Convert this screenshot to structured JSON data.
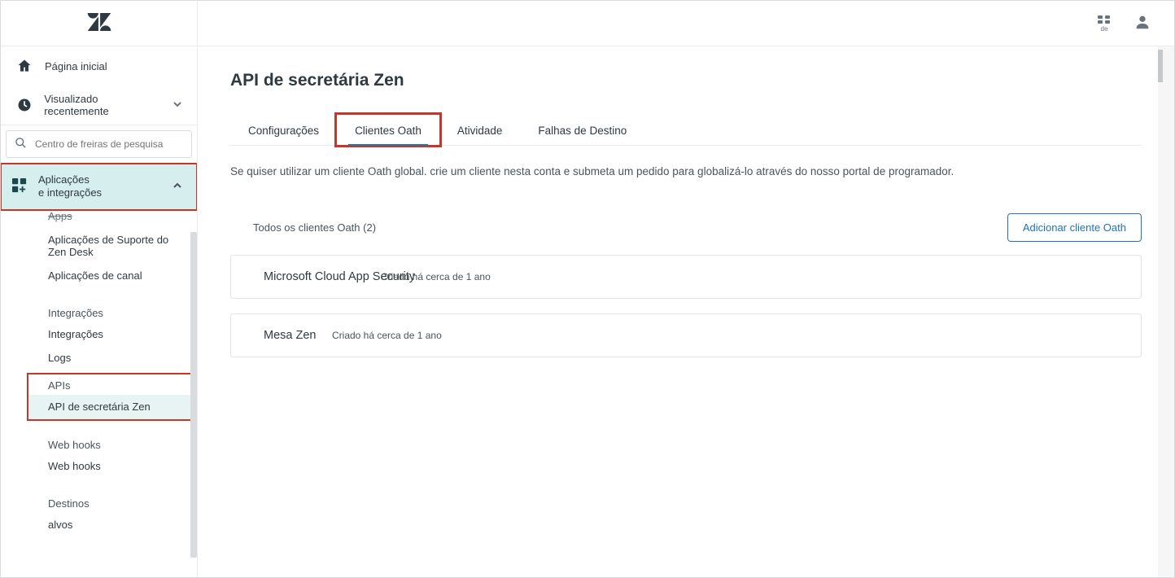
{
  "topbar": {
    "apps_caption": "de"
  },
  "sidebar": {
    "home": "Página inicial",
    "recent": "Visualizado recentemente",
    "search_placeholder": "Centro de freiras de pesquisa",
    "section_apps_line1": "Aplicações",
    "section_apps_line2": "e integrações",
    "items": {
      "apps_partial": "Apps",
      "support_apps": "Aplicações de Suporte do Zen Desk",
      "channel_apps": "Aplicações de canal",
      "integrations_group": "Integrações",
      "integrations": "Integrações",
      "logs": "Logs",
      "apis_group": "APIs",
      "zen_api": "API de secretária Zen",
      "webhooks_group": "Web hooks",
      "webhooks": "Web hooks",
      "targets_group": "Destinos",
      "targets": "alvos"
    }
  },
  "main": {
    "title": "API de secretária Zen",
    "tabs": {
      "settings": "Configurações",
      "oauth": "Clientes Oath",
      "activity": "Atividade",
      "failures": "Falhas de Destino"
    },
    "description": "Se quiser utilizar um cliente Oath global. crie um cliente nesta conta e submeta um pedido para globalizá-lo através do nosso portal de programador.",
    "list_header": "Todos os clientes Oath (2)",
    "add_button": "Adicionar cliente Oath",
    "clients": [
      {
        "name": "Microsoft Cloud App Security",
        "meta": "Criado há cerca de 1 ano"
      },
      {
        "name": "Mesa Zen",
        "meta": "Criado há cerca de 1 ano"
      }
    ]
  }
}
